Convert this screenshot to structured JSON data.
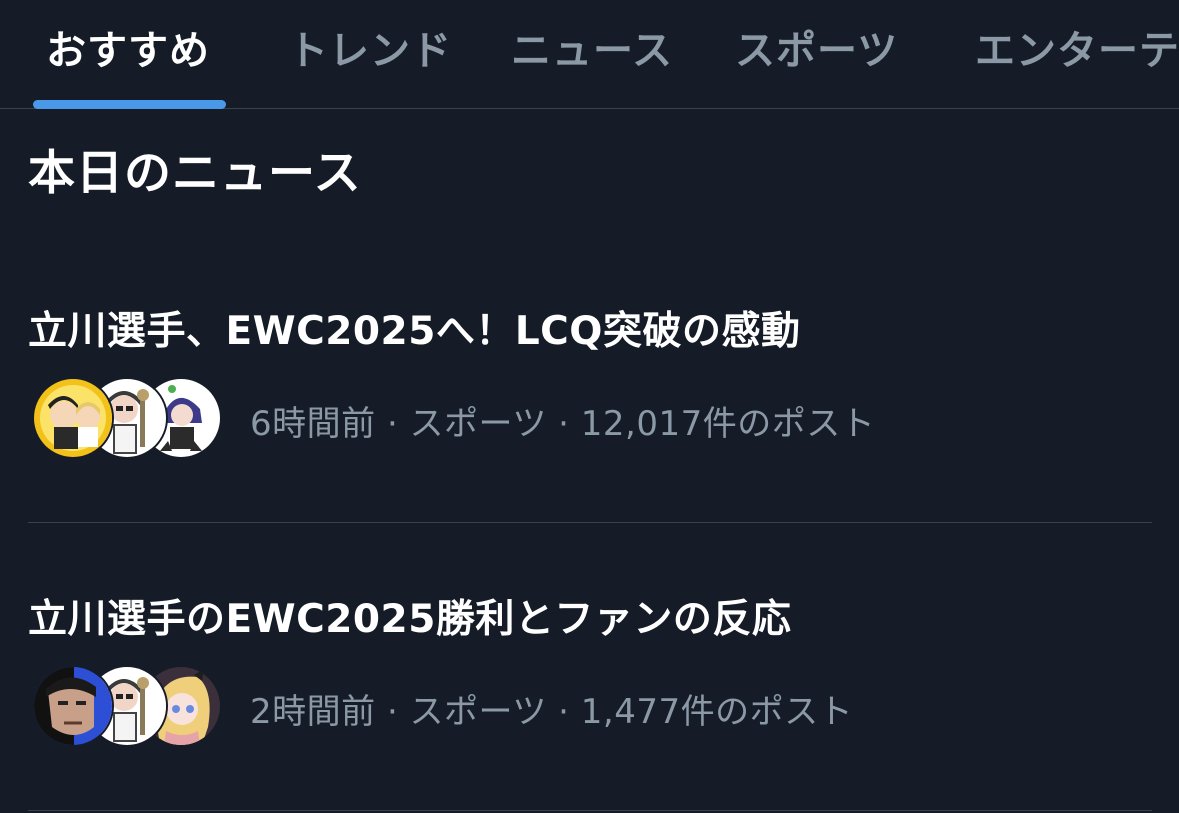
{
  "tabs": [
    {
      "label": "おすすめ",
      "active": true
    },
    {
      "label": "トレンド",
      "active": false
    },
    {
      "label": "ニュース",
      "active": false
    },
    {
      "label": "スポーツ",
      "active": false
    },
    {
      "label": "エンターテ",
      "active": false
    }
  ],
  "section_title": "本日のニュース",
  "news": [
    {
      "headline": "立川選手、EWC2025へ！LCQ突破の感動",
      "meta": "6時間前 · スポーツ · 12,017件のポスト",
      "avatars": [
        "avatar-yellow-duo",
        "avatar-cartoon-white",
        "avatar-purple-hair"
      ]
    },
    {
      "headline": "立川選手のEWC2025勝利とファンの反応",
      "meta": "2時間前 · スポーツ · 1,477件のポスト",
      "avatars": [
        "avatar-dark-face",
        "avatar-cartoon-white",
        "avatar-blonde-anime"
      ]
    }
  ],
  "colors": {
    "background": "#151c27",
    "accent": "#4a99e9",
    "muted_text": "#8b98a5",
    "divider": "#38444d"
  }
}
